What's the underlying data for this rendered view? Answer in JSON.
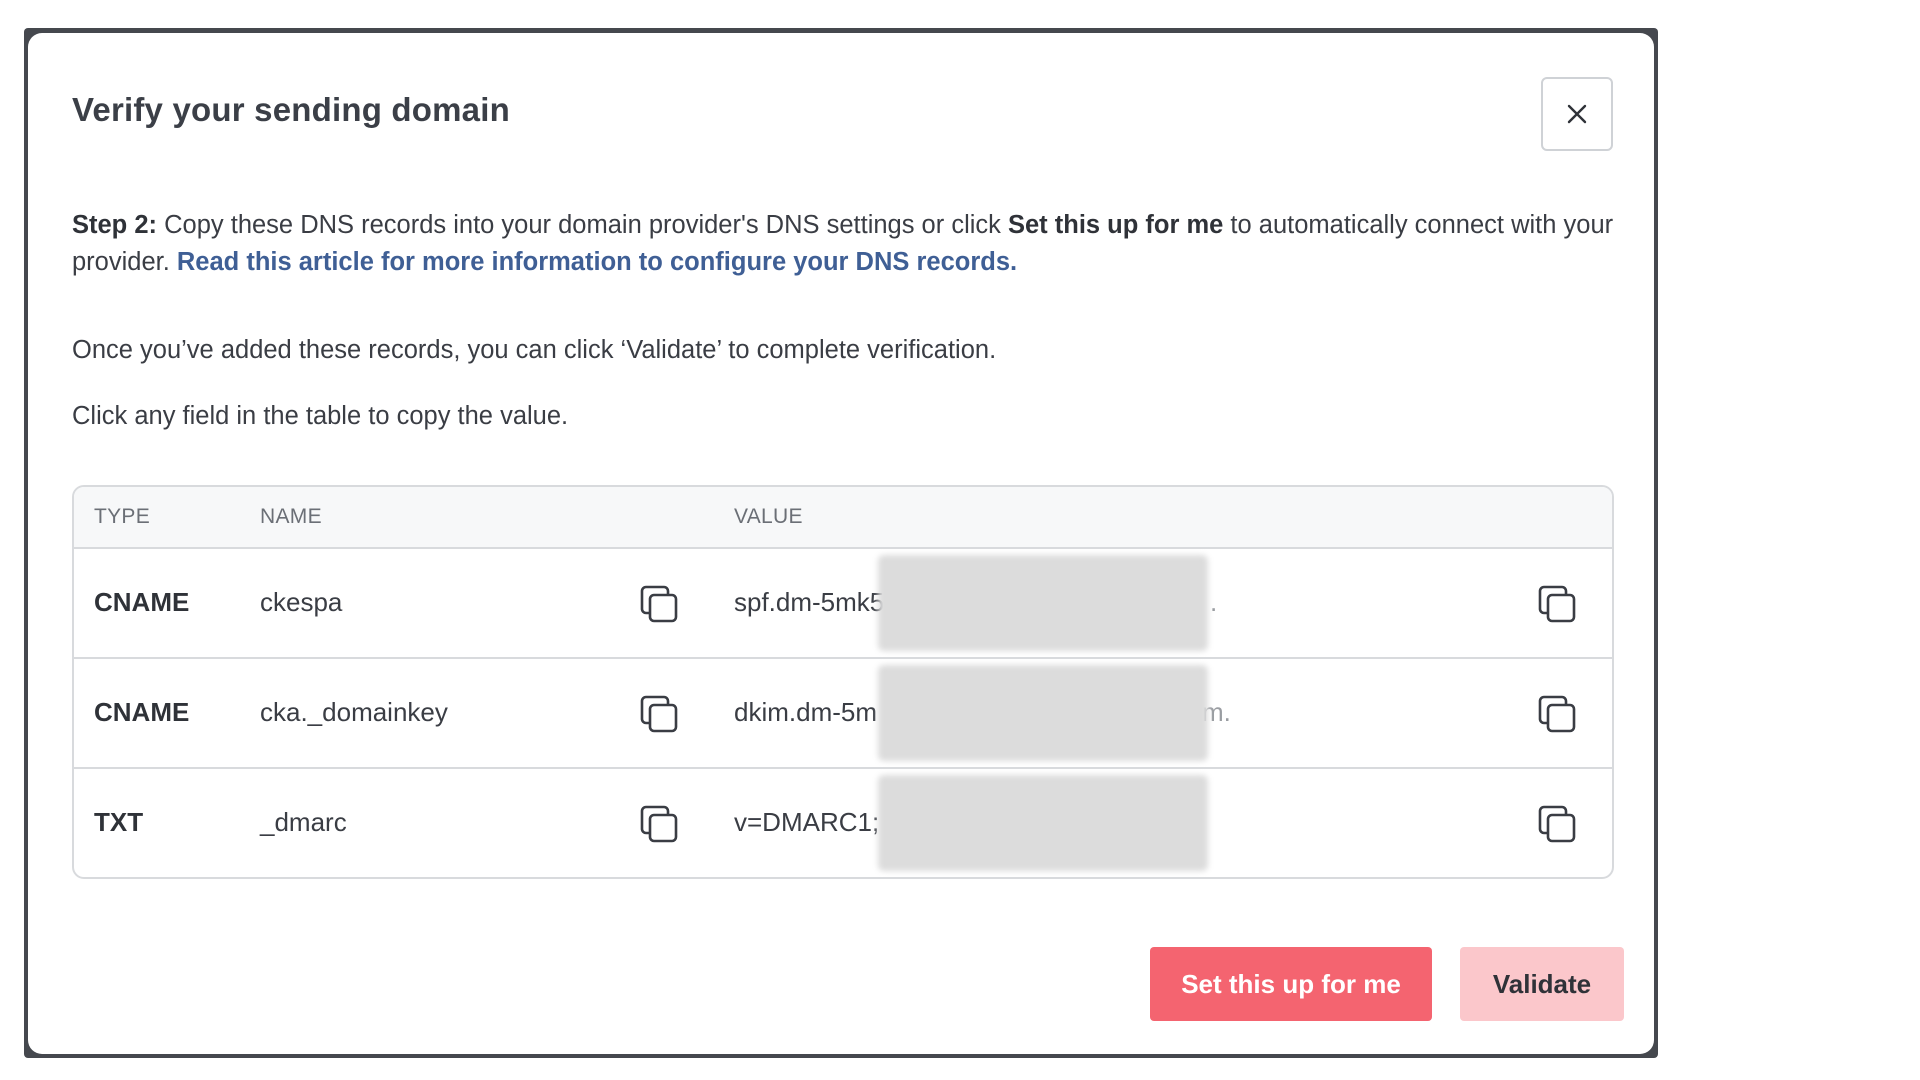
{
  "modal": {
    "title": "Verify your sending domain",
    "close_icon": "close-icon"
  },
  "instructions": {
    "step_label": "Step 2:",
    "step_text_1": " Copy these DNS records into your domain provider's DNS settings or click ",
    "setup_emphasis": "Set this up for me",
    "step_text_2": " to automatically connect with your provider. ",
    "article_link": "Read this article for more information to configure your DNS records.",
    "validate_note": "Once you’ve added these records, you can click ‘Validate’ to complete verification.",
    "copy_note": "Click any field in the table to copy the value."
  },
  "table": {
    "headers": {
      "type": "TYPE",
      "name": "NAME",
      "value": "VALUE"
    },
    "rows": [
      {
        "type": "CNAME",
        "name": "ckespa",
        "value": "spf.dm-5mk5",
        "value_tail": "."
      },
      {
        "type": "CNAME",
        "name": "cka._domainkey",
        "value": "dkim.dm-5m",
        "value_tail": "m."
      },
      {
        "type": "TXT",
        "name": "_dmarc",
        "value": "v=DMARC1; p",
        "value_tail": ""
      }
    ],
    "copy_icon": "copy-icon"
  },
  "buttons": {
    "setup_label": "Set this up for me",
    "validate_label": "Validate"
  },
  "colors": {
    "primary": "#f46470",
    "primary_disabled": "#fbc7cb",
    "link": "#3f5f95"
  }
}
